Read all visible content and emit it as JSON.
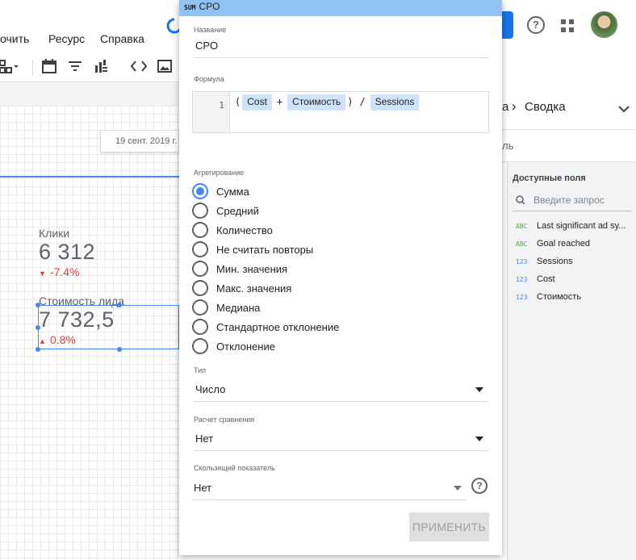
{
  "menu": {
    "item1": "очить",
    "item2": "Ресурс",
    "item3": "Справка"
  },
  "report": {
    "date_range": "19 сент. 2019 г.",
    "kpi1": {
      "label": "Клики",
      "value": "6 312",
      "delta": "-7.4%"
    },
    "kpi2": {
      "label": "Стоимость лида",
      "value": "7 732,5",
      "delta": "0.8%"
    }
  },
  "right_panel": {
    "breadcrumb": "Сводка",
    "subtab": "ль",
    "fields_title": "Доступные поля",
    "search_placeholder": "Введите запрос",
    "fields": [
      {
        "type": "ABC",
        "name": "Last significant ad sy..."
      },
      {
        "type": "ABC",
        "name": "Goal reached"
      },
      {
        "type": "123",
        "name": "Sessions"
      },
      {
        "type": "123",
        "name": "Cost"
      },
      {
        "type": "123",
        "name": "Стоимость"
      }
    ]
  },
  "dialog": {
    "header_badge": "SUM",
    "header_title": "CPO",
    "name_label": "Название",
    "name_value": "CPO",
    "formula_label": "Формула",
    "formula_line": "1",
    "formula": {
      "open": "(",
      "chip1": "Cost",
      "op1": "+",
      "chip2": "Стоимость",
      "close": ")",
      "op2": "/",
      "chip3": "Sessions"
    },
    "aggregation_label": "Агрегирование",
    "aggregation_options": [
      {
        "label": "Сумма",
        "checked": true
      },
      {
        "label": "Средний",
        "checked": false
      },
      {
        "label": "Количество",
        "checked": false
      },
      {
        "label": "Не считать повторы",
        "checked": false
      },
      {
        "label": "Мин. значения",
        "checked": false
      },
      {
        "label": "Макс. значения",
        "checked": false
      },
      {
        "label": "Медиана",
        "checked": false
      },
      {
        "label": "Стандартное отклонение",
        "checked": false
      },
      {
        "label": "Отклонение",
        "checked": false
      }
    ],
    "type_label": "Тип",
    "type_value": "Число",
    "comparison_label": "Расчет сравнения",
    "comparison_value": "Нет",
    "running_label": "Скользящий показатель",
    "running_value": "Нет",
    "apply_label": "ПРИМЕНИТЬ"
  },
  "colors": {
    "accent": "#4285f4",
    "header": "#90c2f4",
    "negative": "#e53935",
    "chip": "#cfe3fa"
  }
}
